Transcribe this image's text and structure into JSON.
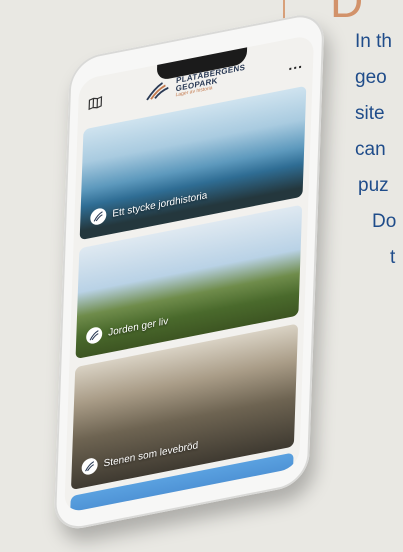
{
  "article": {
    "drop_letter": "D",
    "lines": [
      "In th",
      "geo",
      "site",
      "can",
      "puz",
      "Do",
      "t"
    ]
  },
  "app": {
    "logo_title_line1": "PLATÅBERGENS",
    "logo_title_line2": "GEOPARK",
    "logo_subtitle": "Lager av historia",
    "menu_icon": "map-icon",
    "more_icon": "more-dots-icon",
    "more_label": "..."
  },
  "cards": [
    {
      "label": "Ett stycke jordhistoria"
    },
    {
      "label": "Jorden ger liv"
    },
    {
      "label": "Stenen som levebröd"
    }
  ]
}
